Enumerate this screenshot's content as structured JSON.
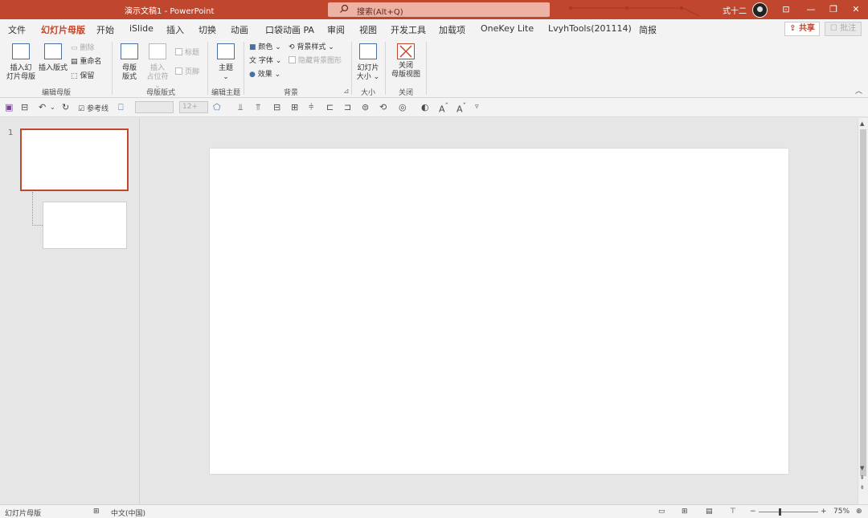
{
  "title": {
    "doc": "演示文稿1",
    "sep": "-",
    "app": "PowerPoint",
    "search_placeholder": "搜索(Alt+Q)",
    "user": "式十二",
    "window_buttons": {
      "ribbon_display": "⊡",
      "minimize": "—",
      "restore": "❐",
      "close": "✕"
    }
  },
  "tabs": [
    {
      "label": "文件"
    },
    {
      "label": "幻灯片母版",
      "active": true
    },
    {
      "label": "开始"
    },
    {
      "label": "iSlide"
    },
    {
      "label": "插入"
    },
    {
      "label": "切换"
    },
    {
      "label": "动画"
    },
    {
      "label": "口袋动画 PA"
    },
    {
      "label": "审阅"
    },
    {
      "label": "视图"
    },
    {
      "label": "开发工具"
    },
    {
      "label": "加载项"
    },
    {
      "label": "OneKey Lite"
    },
    {
      "label": "LvyhTools(201114)"
    },
    {
      "label": "简报"
    }
  ],
  "share": "共享",
  "comment": "批注",
  "ribbon": {
    "edit_master": {
      "insert_master_1": "插入幻",
      "insert_master_2": "灯片母版",
      "insert_layout": "插入版式",
      "delete": "删除",
      "rename": "重命名",
      "preserve": "保留",
      "label": "编辑母版"
    },
    "master_layout": {
      "master_1": "母版",
      "master_2": "版式",
      "placeholder_1": "插入",
      "placeholder_2": "占位符",
      "title_chk": "标题",
      "footer_chk": "页脚",
      "label": "母版版式"
    },
    "edit_theme": {
      "themes": "主题",
      "label": "编辑主题"
    },
    "background": {
      "colors": "颜色",
      "fonts": "字体",
      "effects": "效果",
      "bg_styles": "背景样式",
      "hide_bg": "隐藏背景图形",
      "label": "背景"
    },
    "size": {
      "slide_size_1": "幻灯片",
      "slide_size_2": "大小",
      "label": "大小"
    },
    "close": {
      "close_1": "关闭",
      "close_2": "母版视图",
      "label": "关闭"
    }
  },
  "qat": {
    "guides": "参考线",
    "font_size": "12+"
  },
  "thumbnails": {
    "slide_number": "1"
  },
  "status": {
    "view_name": "幻灯片母版",
    "language": "中文(中国)",
    "zoom": "75%",
    "zoom_minus": "−",
    "zoom_plus": "+"
  }
}
